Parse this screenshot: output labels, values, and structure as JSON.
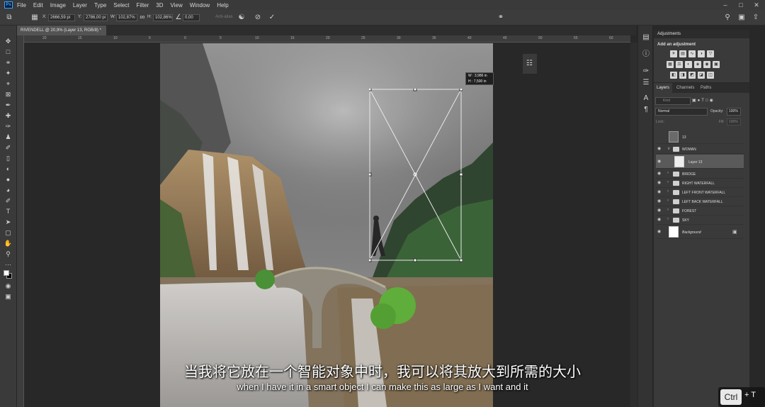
{
  "app": {
    "logo": "Ps",
    "accent": "#31a8ff"
  },
  "menu": [
    "File",
    "Edit",
    "Image",
    "Layer",
    "Type",
    "Select",
    "Filter",
    "3D",
    "View",
    "Window",
    "Help"
  ],
  "options": {
    "x_label": "X:",
    "x_value": "2666,59 pi",
    "y_label": "Y:",
    "y_value": "2786,00 pi",
    "w_label": "W:",
    "w_value": "102,87%",
    "h_label": "H:",
    "h_value": "102,86%",
    "angle_value": "0,00",
    "interp": "Anti-alias"
  },
  "doc_tab": "RIVENDELL @ 20,9% (Layer 13, RGB/8) *",
  "ruler_ticks": [
    "20",
    "15",
    "10",
    "5",
    "0",
    "5",
    "10",
    "15",
    "20",
    "25",
    "30",
    "35",
    "40",
    "45",
    "50",
    "55",
    "60",
    "65"
  ],
  "transform_info": {
    "w": "W : 3,986 in",
    "h": "H : 7,500 in"
  },
  "adjustments": {
    "title": "Adjustments",
    "subtitle": "Add an adjustment"
  },
  "layers_panel": {
    "tabs": [
      "Layers",
      "Channels",
      "Paths"
    ],
    "search_placeholder": "Kind",
    "blend_mode": "Normal",
    "opacity_label": "Opacity:",
    "opacity_value": "100%",
    "lock_label": "Lock:",
    "fill_label": "Fill:",
    "fill_value": "100%",
    "layers": [
      {
        "name": "13",
        "type": "image"
      },
      {
        "name": "WOMAN",
        "type": "group-open"
      },
      {
        "name": "Layer 13",
        "type": "smart",
        "selected": true
      },
      {
        "name": "BRIDGE",
        "type": "group"
      },
      {
        "name": "RIGHT WATERFALL",
        "type": "group"
      },
      {
        "name": "LEFT FRONT WATERFALL",
        "type": "group"
      },
      {
        "name": "LEFT BACK WATERFALL",
        "type": "group"
      },
      {
        "name": "FOREST",
        "type": "group"
      },
      {
        "name": "SKY",
        "type": "group"
      },
      {
        "name": "Background",
        "type": "background"
      }
    ]
  },
  "captions": {
    "cn": "当我将它放在一个智能对象中时，我可以将其放大到所需的大小",
    "en": "when I have it in a smart object I can make this as large as I want and it"
  },
  "shortcut": {
    "key": "Ctrl",
    "rest": "+ T"
  }
}
